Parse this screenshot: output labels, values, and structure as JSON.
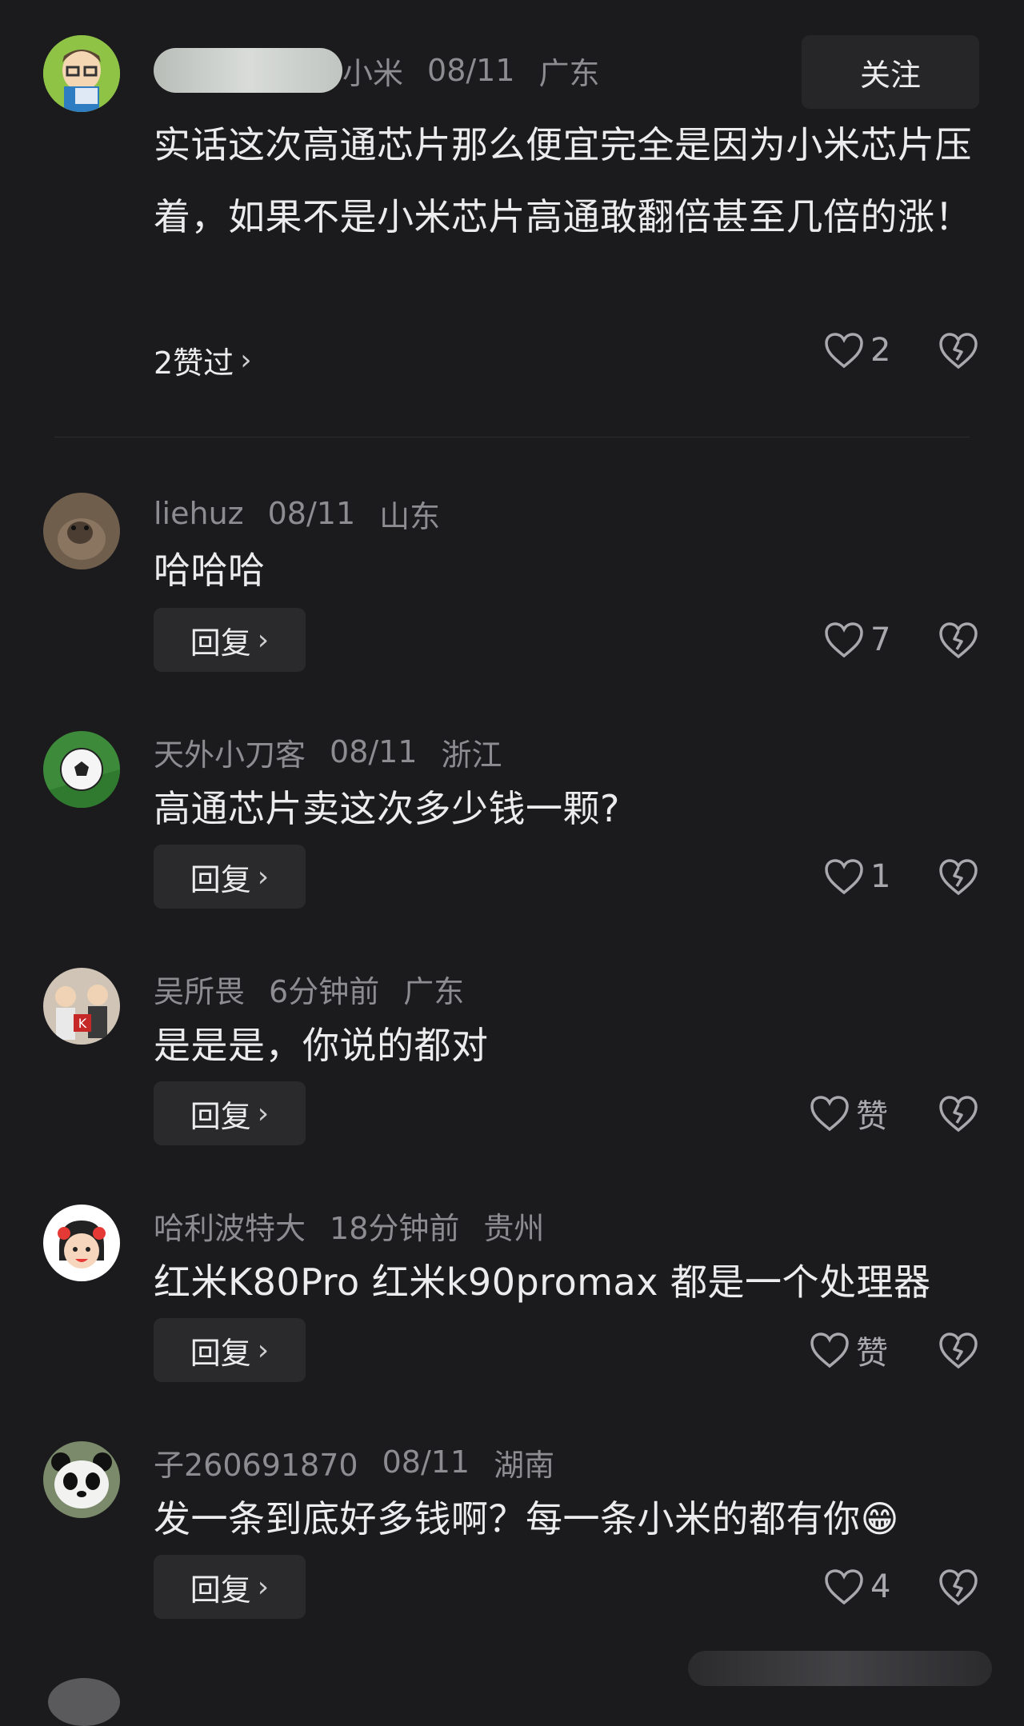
{
  "top_comment": {
    "username": "小米",
    "date": "08/11",
    "location": "广东",
    "follow_label": "关注",
    "text": "实话这次高通芯片那么便宜完全是因为小米芯片压着，如果不是小米芯片高通敢翻倍甚至几倍的涨！",
    "replies_link": "2赞过",
    "likes": "2"
  },
  "reply_label": "回复",
  "comments": [
    {
      "username": "liehuz",
      "date": "08/11",
      "location": "山东",
      "text": "哈哈哈",
      "likes": "7"
    },
    {
      "username": "天外小刀客",
      "date": "08/11",
      "location": "浙江",
      "text": "高通芯片卖这次多少钱一颗?",
      "likes": "1"
    },
    {
      "username": "吴所畏",
      "date": "6分钟前",
      "location": "广东",
      "text": "是是是，你说的都对",
      "likes": "赞"
    },
    {
      "username": "哈利波特大",
      "date": "18分钟前",
      "location": "贵州",
      "text": "红米K80Pro 红米k90promax 都是一个处理器",
      "likes": "赞"
    },
    {
      "username": "子260691870",
      "date": "08/11",
      "location": "湖南",
      "text": "发一条到底好多钱啊？每一条小米的都有你😁",
      "likes": "4"
    }
  ],
  "colors": {
    "background": "#1b1b1d",
    "text": "#ececee",
    "meta": "#8d8d91",
    "button": "#2a2a2d"
  }
}
